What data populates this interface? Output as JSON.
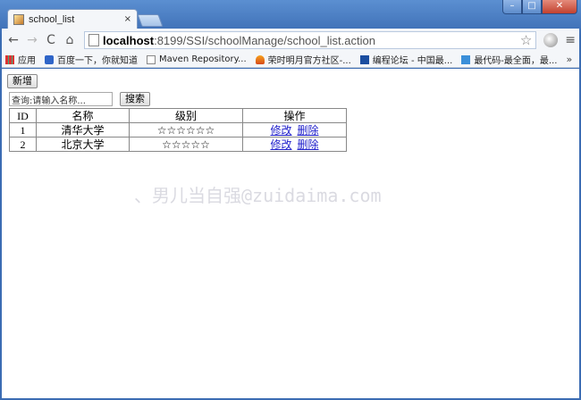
{
  "window": {
    "controls": {
      "minimize": "–",
      "maximize": "□",
      "close": "✕"
    }
  },
  "tab": {
    "title": "school_list",
    "close": "×"
  },
  "toolbar": {
    "back": "←",
    "forward": "→",
    "reload": "C",
    "home": "⌂",
    "url_host": "localhost",
    "url_rest": ":8199/SSI/schoolManage/school_list.action",
    "bookmark_star": "☆",
    "menu": "≡"
  },
  "bookmarks": {
    "items": [
      {
        "label": "应用",
        "icon": "apps-icon"
      },
      {
        "label": "百度一下，你就知道",
        "icon": "baidu-paw-icon"
      },
      {
        "label": "Maven Repository...",
        "icon": "page-icon"
      },
      {
        "label": "荣时明月官方社区-...",
        "icon": "flame-icon"
      },
      {
        "label": "编程论坛 - 中国最...",
        "icon": "code-icon"
      },
      {
        "label": "最代码-最全面，最...",
        "icon": "zuidaima-icon"
      }
    ],
    "more": "»"
  },
  "page": {
    "add_label": "新增",
    "search_value": "查询:请输入名称...",
    "search_label": "搜索",
    "table": {
      "headers": {
        "id": "ID",
        "name": "名称",
        "level": "级别",
        "ops": "操作"
      },
      "rows": [
        {
          "id": "1",
          "name": "清华大学",
          "level": "☆☆☆☆☆☆",
          "edit": "修改",
          "delete": "删除"
        },
        {
          "id": "2",
          "name": "北京大学",
          "level": "☆☆☆☆☆",
          "edit": "修改",
          "delete": "删除"
        }
      ]
    },
    "watermark": "、男儿当自强@zuidaima.com"
  }
}
